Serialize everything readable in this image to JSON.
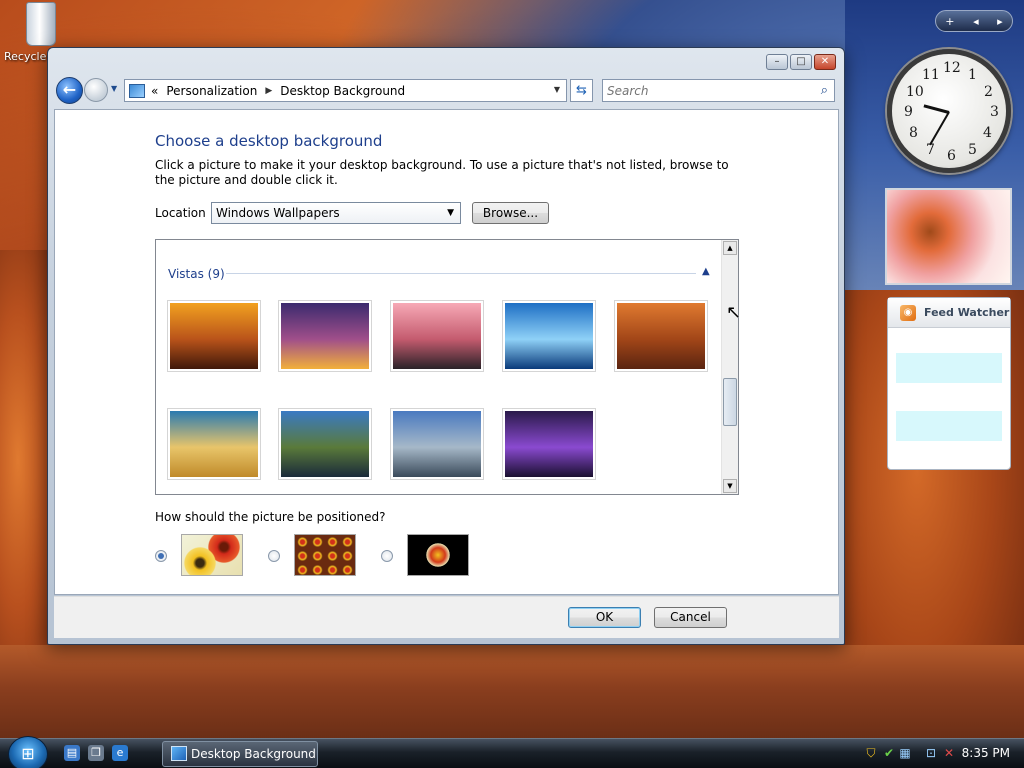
{
  "desktop": {
    "recycle_label": "Recycle"
  },
  "window": {
    "title": "Desktop Background",
    "breadcrumb": [
      "Personalization",
      "Desktop Background"
    ],
    "search_placeholder": "Search",
    "page_title": "Choose a desktop background",
    "page_desc": "Click a picture to make it your desktop background. To use a picture that's not listed, browse to the picture and double click it.",
    "location_label": "Location",
    "location_value": "Windows Wallpapers",
    "browse_label": "Browse...",
    "group_label": "Vistas (9)",
    "thumbnails": [
      {
        "name": "Vista sunset canyon",
        "colors": [
          "#f2a11f",
          "#b9531a",
          "#40180a"
        ]
      },
      {
        "name": "Vista bridge night",
        "colors": [
          "#3b2a6e",
          "#a04f8a",
          "#f2b03a"
        ]
      },
      {
        "name": "Vista pink sunset rocks",
        "colors": [
          "#f7a9b6",
          "#c45b6e",
          "#2a2228"
        ]
      },
      {
        "name": "Vista blue islands",
        "colors": [
          "#1e6fc4",
          "#8fd1f7",
          "#0a3a7a"
        ]
      },
      {
        "name": "Vista rock arch",
        "colors": [
          "#e07a30",
          "#a24618",
          "#5a2410"
        ]
      },
      {
        "name": "Vista dunes",
        "colors": [
          "#2a7ab0",
          "#e8c56a",
          "#c08a2a"
        ]
      },
      {
        "name": "Vista mountain lake",
        "colors": [
          "#3a7ac4",
          "#5a7a3a",
          "#1a2a3a"
        ]
      },
      {
        "name": "Vista cliff sea",
        "colors": [
          "#4a7ac0",
          "#a6b8c8",
          "#3a4a5a"
        ]
      },
      {
        "name": "Vista aurora purple",
        "colors": [
          "#2a1a4a",
          "#8a4ad0",
          "#1a1030"
        ]
      }
    ],
    "position_label": "How should the picture be positioned?",
    "position_options": [
      "fit-to-screen",
      "tile",
      "center"
    ],
    "position_selected": "fit-to-screen",
    "ok_label": "OK",
    "cancel_label": "Cancel"
  },
  "gadgets": {
    "clock_numbers": [
      "12",
      "1",
      "2",
      "3",
      "4",
      "5",
      "6",
      "7",
      "8",
      "9",
      "10",
      "11"
    ],
    "feed_title": "Feed Watcher"
  },
  "taskbar": {
    "active_task": "Desktop Background",
    "time": "8:35 PM"
  },
  "colors": {
    "link_blue": "#1e3f8c",
    "taskbar_dark": "#1a2129"
  }
}
